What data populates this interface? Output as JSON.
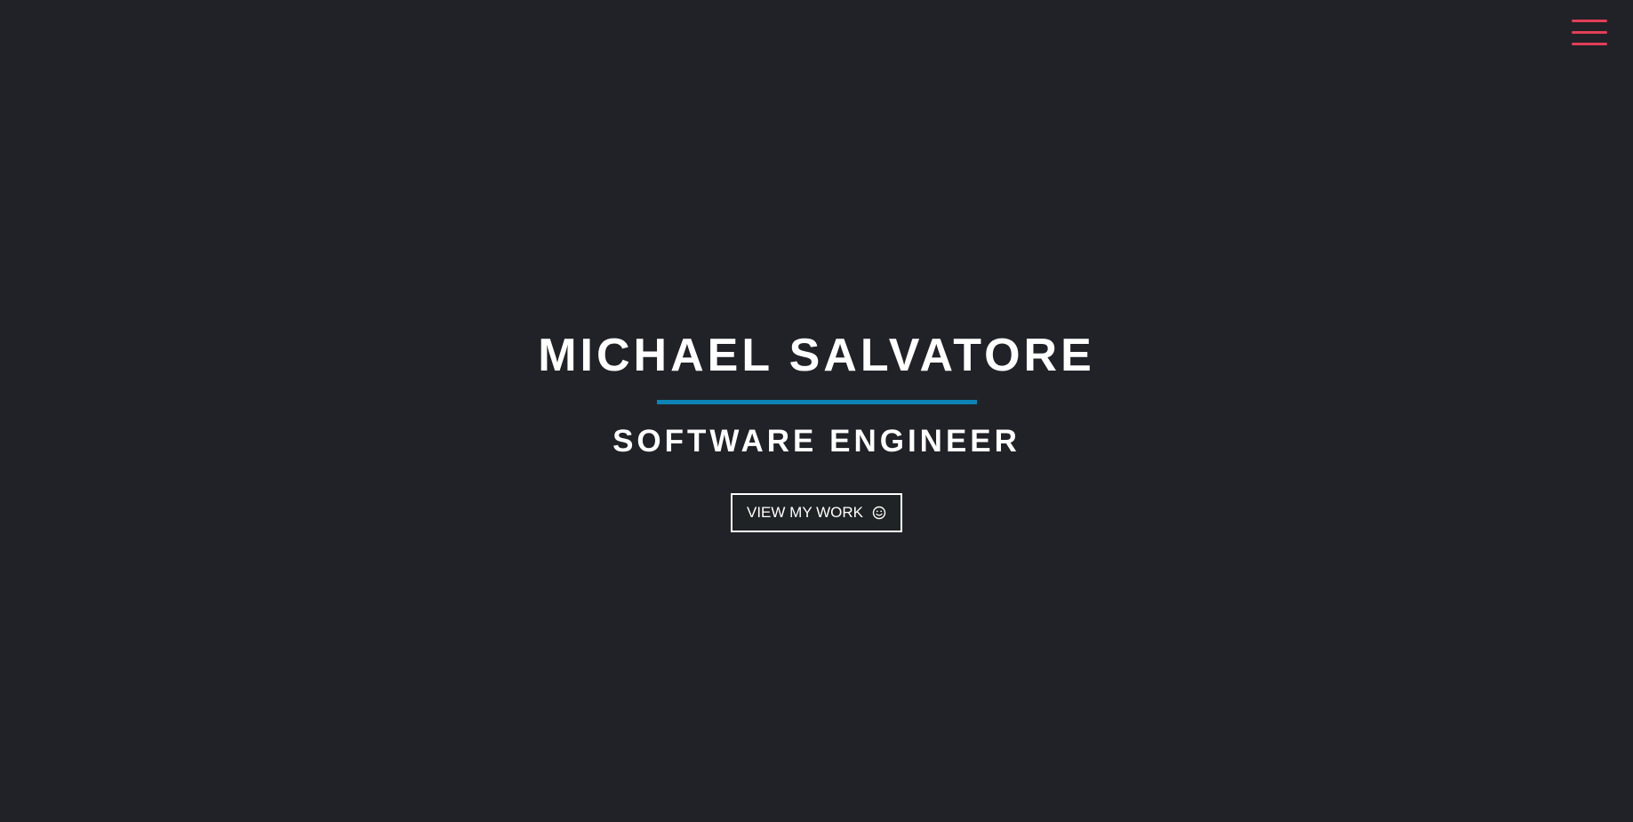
{
  "nav": {
    "menu_icon": "hamburger-menu-icon",
    "accent_color": "#e23e57"
  },
  "hero": {
    "name": "MICHAEL SALVATORE",
    "divider_color": "#0b84b5",
    "role": "SOFTWARE ENGINEER",
    "cta_label": "VIEW MY WORK",
    "cta_icon": "smiley-face-icon"
  },
  "colors": {
    "background": "#212227",
    "text": "#ffffff"
  }
}
